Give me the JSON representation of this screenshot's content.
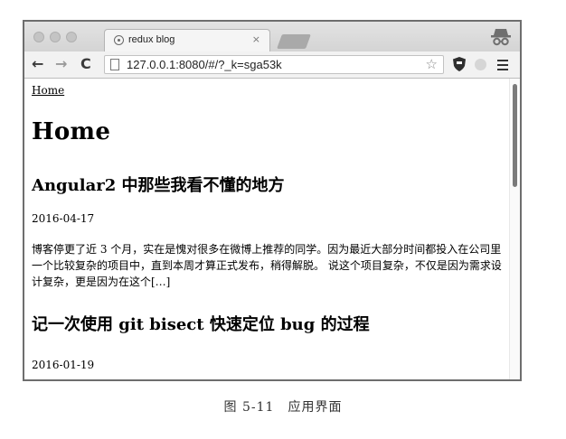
{
  "browser": {
    "tab_title": "redux blog",
    "tab_close": "×",
    "url": "127.0.0.1:8080/#/?_k=sga53k",
    "back_glyph": "←",
    "forward_glyph": "→",
    "reload_glyph": "C",
    "star_glyph": "☆",
    "icons": {
      "tab_favicon": "globe-icon",
      "incognito": "incognito-icon",
      "page": "page-icon",
      "extension_shield": "shield-extension-icon",
      "extension_circle": "circle-extension-icon",
      "menu": "hamburger-menu-icon"
    }
  },
  "page": {
    "nav_home_link": "Home",
    "title": "Home",
    "posts": [
      {
        "title": "Angular2 中那些我看不懂的地方",
        "date": "2016-04-17",
        "excerpt": "博客停更了近 3 个月，实在是愧对很多在微博上推荐的同学。因为最近大部分时间都投入在公司里一个比较复杂的项目中，直到本周才算正式发布，稍得解脱。 说这个项目复杂，不仅是因为需求设计复杂，更是因为在这个[…]"
      },
      {
        "title": "记一次使用 git bisect 快速定位 bug 的过程",
        "date": "2016-01-19"
      }
    ]
  },
  "caption": "图 5-11　应用界面",
  "colors": {
    "titlebar": "#d8d8d8",
    "toolbar": "#f2f2f2",
    "frame": "#6e6e6e",
    "text": "#000000"
  }
}
